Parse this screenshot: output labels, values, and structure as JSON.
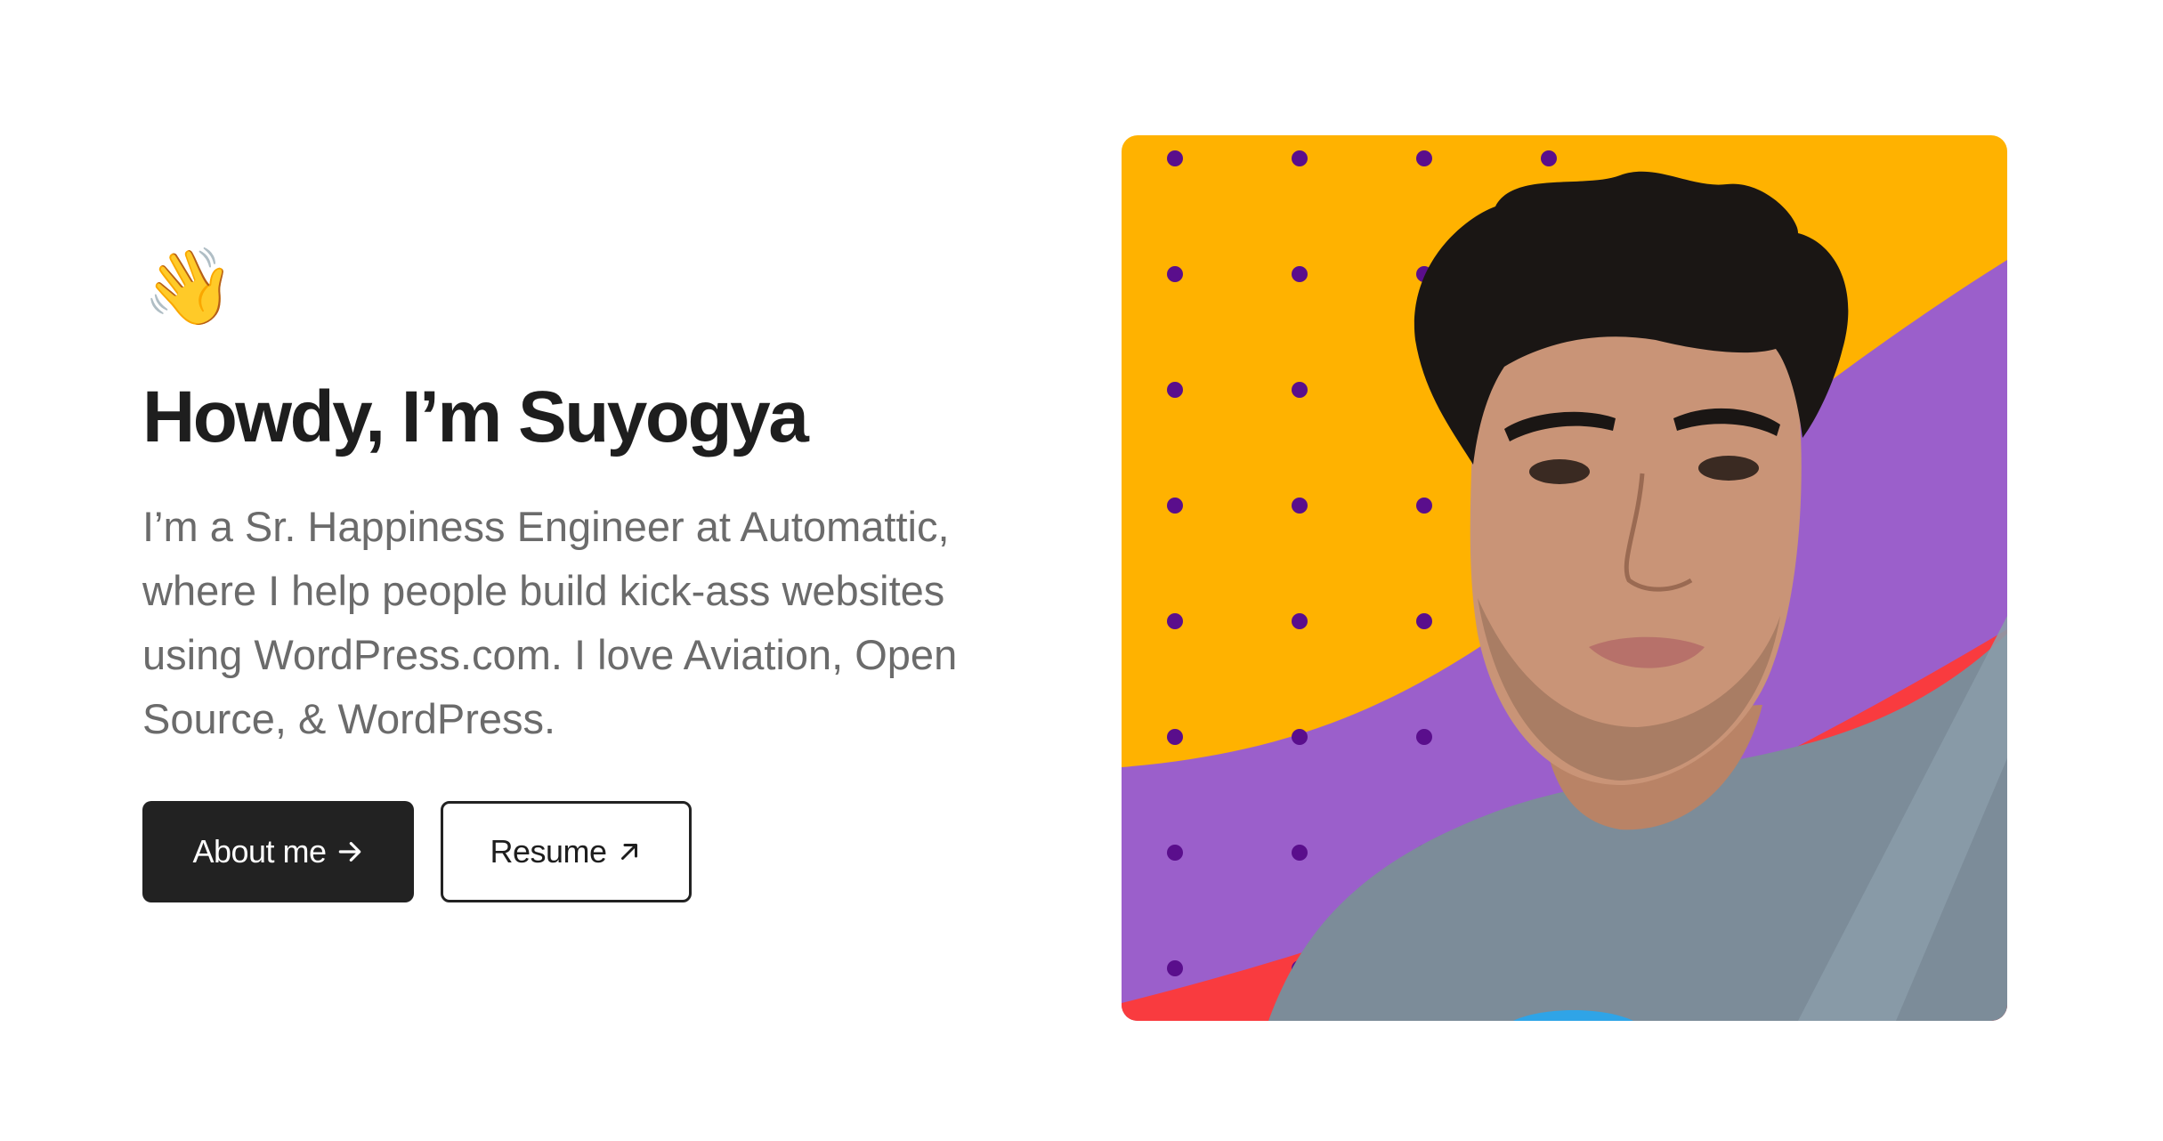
{
  "hero": {
    "wave_emoji": "👋",
    "title": "Howdy, I’m Suyogya",
    "bio": "I’m a Sr. Happiness Engineer at Automattic, where I help people build kick-ass websites using WordPress.com. I love Aviation, Open Source, & WordPress.",
    "buttons": {
      "about_label": "About me",
      "about_icon": "arrow-right-icon",
      "resume_label": "Resume",
      "resume_icon": "arrow-up-right-icon"
    }
  },
  "portrait": {
    "colors": {
      "yellow": "#FFB200",
      "purple": "#9B5FCB",
      "red": "#F93B3F",
      "dots": "#5A0E8C"
    }
  }
}
